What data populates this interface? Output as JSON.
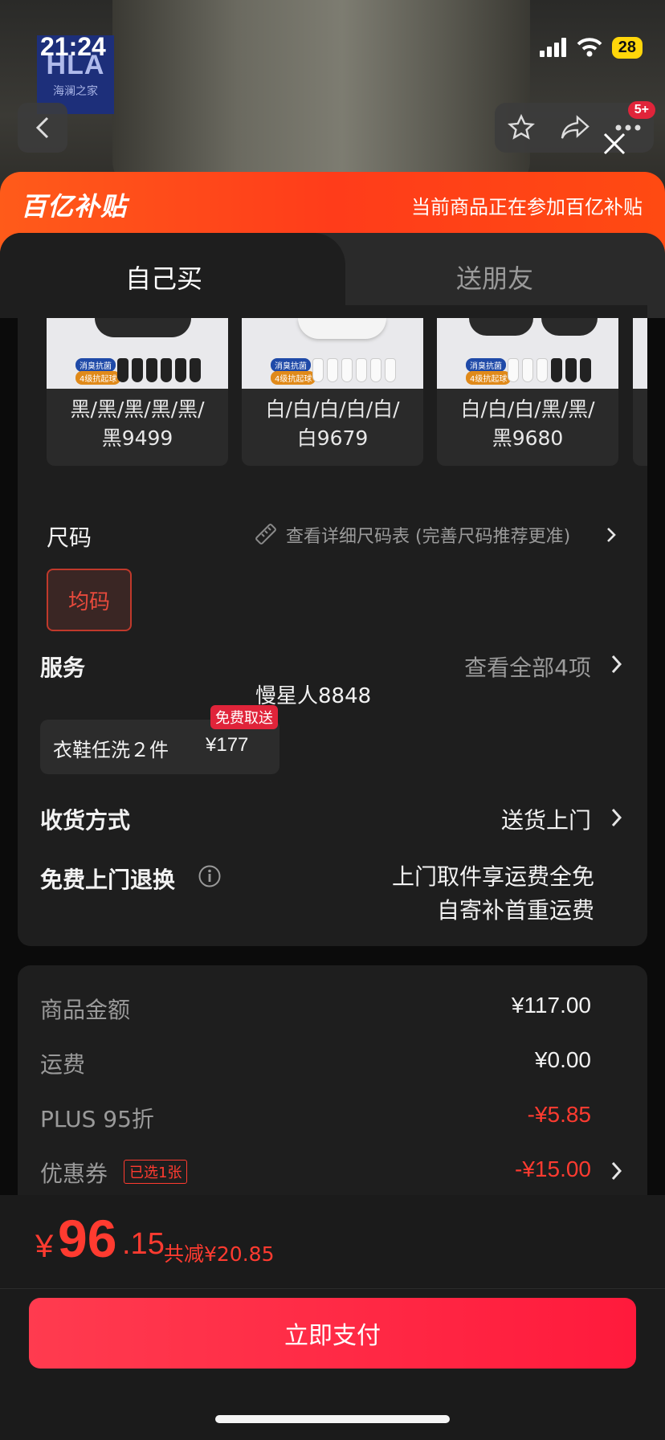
{
  "status_bar": {
    "time": "21:24",
    "battery": "28"
  },
  "background": {
    "brand_logo_line1": "HLA",
    "brand_logo_line2": "海澜之家",
    "nav_badge": "5+"
  },
  "banner": {
    "logo_text": "百亿补贴",
    "message": "当前商品正在参加百亿补贴"
  },
  "tabs": [
    {
      "label": "自己买",
      "active": true
    },
    {
      "label": "送朋友",
      "active": false
    }
  ],
  "swatches": [
    {
      "tags": [
        "消臭抗菌",
        "4级抗起球"
      ],
      "label_line1": "黑/黑/黑/黑/黑/",
      "label_line2": "黑9499"
    },
    {
      "tags": [
        "消臭抗菌",
        "4级抗起球"
      ],
      "label_line1": "白/白/白/白/白/",
      "label_line2": "白9679"
    },
    {
      "tags": [
        "消臭抗菌",
        "4级抗起球"
      ],
      "label_line1": "白/白/白/黑/黑/",
      "label_line2": "黑9680"
    }
  ],
  "size": {
    "label": "尺码",
    "chart_link": "查看详细尺码表 (完善尺码推荐更准)",
    "option": "均码"
  },
  "service": {
    "label": "服务",
    "view_all": "查看全部4项",
    "user_name": "慢星人8848",
    "badge": "免费取送",
    "item_name": "衣鞋任洗２件",
    "item_price": "¥177"
  },
  "delivery": {
    "label": "收货方式",
    "value": "送货上门"
  },
  "return_policy": {
    "label": "免费上门退换",
    "line1": "上门取件享运费全免",
    "line2": "自寄补首重运费"
  },
  "summary": {
    "goods_label": "商品金额",
    "goods_value": "¥117.00",
    "shipping_label": "运费",
    "shipping_value": "¥0.00",
    "plus_label": "PLUS 95折",
    "plus_value": "-¥5.85",
    "coupon_label": "优惠券",
    "coupon_tag": "已选1张",
    "coupon_value": "-¥15.00"
  },
  "footer": {
    "currency": "¥",
    "price_int": "96",
    "price_dec": ".15",
    "total_reduction": "共减¥20.85",
    "pay_button": "立即支付"
  },
  "colors": {
    "accent_red": "#ff3b30",
    "banner_orange": "#ff4a12",
    "background": "#0b0b0b",
    "card": "#1e1e1e"
  }
}
